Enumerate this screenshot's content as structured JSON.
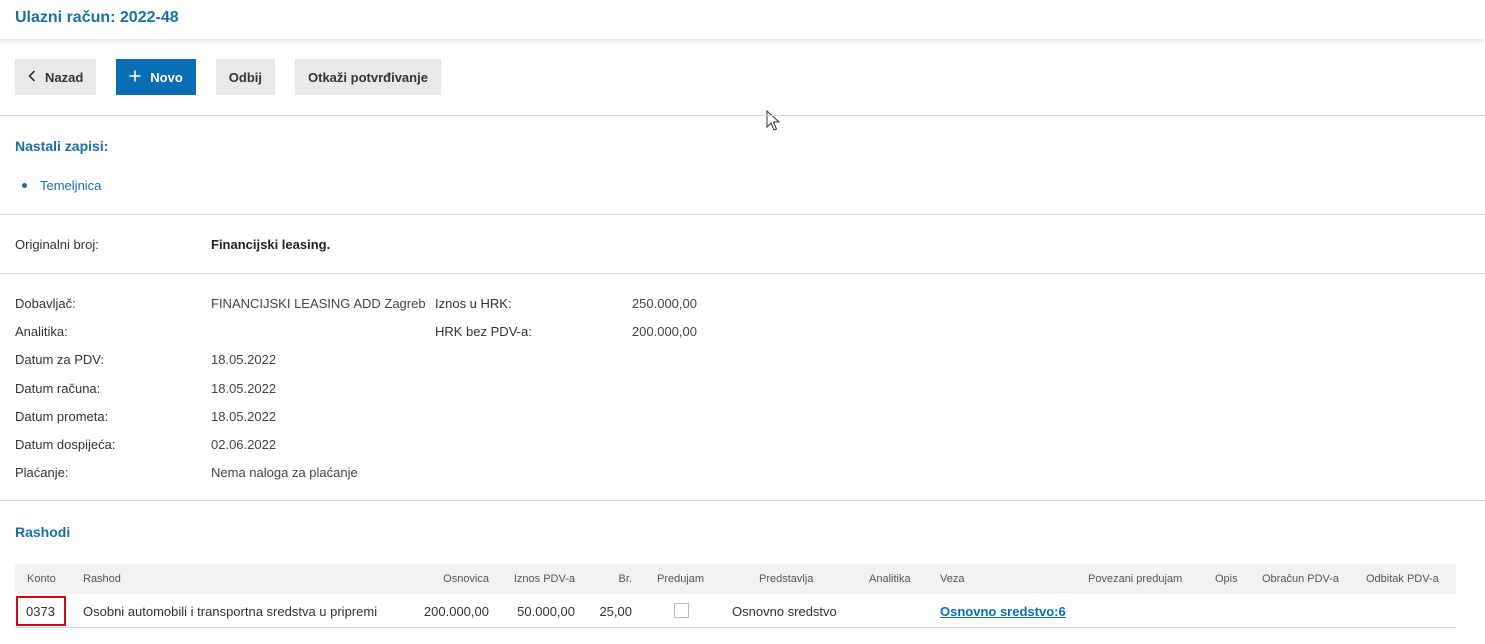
{
  "header": {
    "title": "Ulazni račun: 2022-48"
  },
  "toolbar": {
    "back_label": "Nazad",
    "new_label": "Novo",
    "reject_label": "Odbij",
    "cancel_confirm_label": "Otkaži potvrđivanje"
  },
  "records": {
    "title": "Nastali zapisi:",
    "items": [
      "Temeljnica"
    ]
  },
  "original": {
    "label": "Originalni broj:",
    "value": "Financijski leasing."
  },
  "details": {
    "supplier_label": "Dobavljač:",
    "supplier_value": "FINANCIJSKI LEASING ADD Zagreb",
    "analytics_label": "Analitika:",
    "analytics_value": "",
    "vat_date_label": "Datum za PDV:",
    "vat_date_value": "18.05.2022",
    "invoice_date_label": "Datum računa:",
    "invoice_date_value": "18.05.2022",
    "turnover_date_label": "Datum prometa:",
    "turnover_date_value": "18.05.2022",
    "due_date_label": "Datum dospijeća:",
    "due_date_value": "02.06.2022",
    "payment_label": "Plaćanje:",
    "payment_value": "Nema naloga za plaćanje",
    "amount_label": "Iznos u HRK:",
    "amount_value": "250.000,00",
    "net_label": "HRK bez PDV-a:",
    "net_value": "200.000,00"
  },
  "expenses": {
    "title": "Rashodi",
    "columns": {
      "konto": "Konto",
      "rashod": "Rashod",
      "osnovica": "Osnovica",
      "iznos_pdv": "Iznos PDV-a",
      "br": "Br.",
      "predujam": "Predujam",
      "predstavlja": "Predstavlja",
      "analitika": "Analitika",
      "veza": "Veza",
      "povezani_predujam": "Povezani predujam",
      "opis": "Opis",
      "obracun_pdv": "Obračun PDV-a",
      "odbitak_pdv": "Odbitak PDV-a"
    },
    "rows": [
      {
        "konto": "0373",
        "rashod": "Osobni automobili i transportna sredstva u pripremi",
        "osnovica": "200.000,00",
        "iznos_pdv": "50.000,00",
        "br": "25,00",
        "predujam": false,
        "predstavlja": "Osnovno sredstvo",
        "analitika": "",
        "veza": "Osnovno sredstvo:6",
        "povezani_predujam": "",
        "opis": "",
        "obracun_pdv": "",
        "odbitak_pdv": ""
      }
    ]
  },
  "colors": {
    "accent": "#0a6eb4",
    "title": "#1a6fa8",
    "highlight": "#d0021b"
  }
}
